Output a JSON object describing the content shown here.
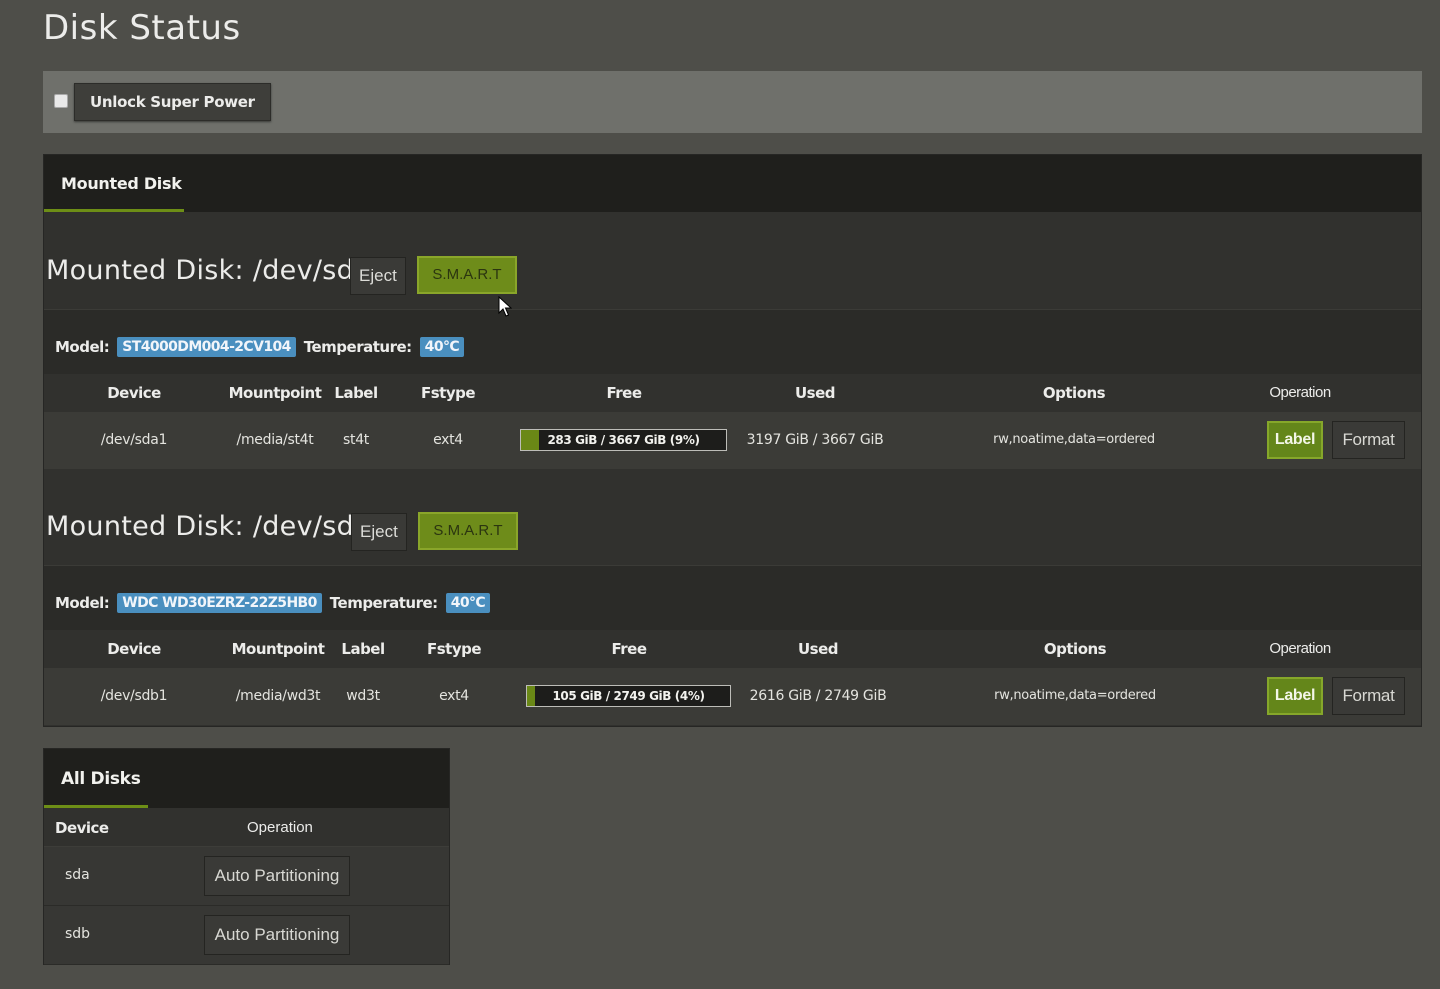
{
  "page": {
    "title": "Disk Status"
  },
  "super_power": {
    "label": "Unlock Super Power"
  },
  "mounted_panel": {
    "tab": "Mounted Disk",
    "columns": {
      "device": "Device",
      "mountpoint": "Mountpoint",
      "label": "Label",
      "fstype": "Fstype",
      "free": "Free",
      "used": "Used",
      "options": "Options",
      "operation": "Operation"
    },
    "disks": [
      {
        "title": "Mounted Disk: /dev/sda",
        "eject": "Eject",
        "smart": "S.M.A.R.T",
        "model_label": "Model:",
        "model": "ST4000DM004-2CV104",
        "temp_label": "Temperature:",
        "temperature": "40°C",
        "partition": {
          "device": "/dev/sda1",
          "mountpoint": "/media/st4t",
          "label": "st4t",
          "fstype": "ext4",
          "free_text": "283 GiB / 3667 GiB (9%)",
          "free_fraction": 0.09,
          "used": "3197 GiB / 3667 GiB",
          "options": "rw,noatime,data=ordered",
          "label_btn": "Label",
          "format_btn": "Format"
        }
      },
      {
        "title": "Mounted Disk: /dev/sdb",
        "eject": "Eject",
        "smart": "S.M.A.R.T",
        "model_label": "Model:",
        "model": "WDC WD30EZRZ-22Z5HB0",
        "temp_label": "Temperature:",
        "temperature": "40°C",
        "partition": {
          "device": "/dev/sdb1",
          "mountpoint": "/media/wd3t",
          "label": "wd3t",
          "fstype": "ext4",
          "free_text": "105 GiB / 2749 GiB (4%)",
          "free_fraction": 0.04,
          "used": "2616 GiB / 2749 GiB",
          "options": "rw,noatime,data=ordered",
          "label_btn": "Label",
          "format_btn": "Format"
        }
      }
    ]
  },
  "all_disks": {
    "tab": "All Disks",
    "col_device": "Device",
    "col_operation": "Operation",
    "rows": [
      {
        "device": "sda",
        "action": "Auto Partitioning"
      },
      {
        "device": "sdb",
        "action": "Auto Partitioning"
      }
    ]
  },
  "colors": {
    "accent": "#6d8e16",
    "badge": "#4a8fbf",
    "background": "#4e4e49"
  }
}
